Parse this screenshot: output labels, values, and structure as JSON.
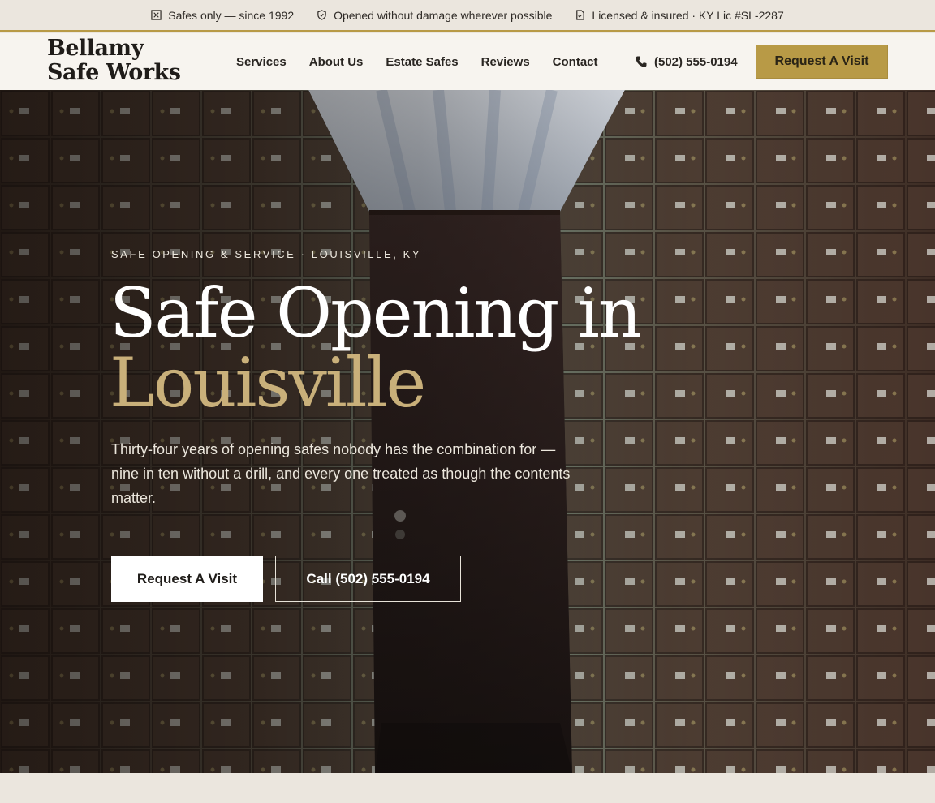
{
  "topbar": {
    "items": [
      {
        "icon": "safe-icon",
        "text": "Safes only — since 1992"
      },
      {
        "icon": "shield-icon",
        "text": "Opened without damage wherever possible"
      },
      {
        "icon": "document-check-icon",
        "text": "Licensed & insured · KY Lic #SL-2287"
      }
    ]
  },
  "header": {
    "logo": "Bellamy Safe Works",
    "nav": [
      "Services",
      "About Us",
      "Estate Safes",
      "Reviews",
      "Contact"
    ],
    "phone": "(502) 555-0194",
    "cta": "Request A Visit"
  },
  "hero": {
    "eyebrow": "Safe Opening & Service · Louisville, KY",
    "title_line1": "Safe Opening in",
    "title_accent": "Louisville",
    "lede": "Thirty-four years of opening safes nobody has the combination for — nine in ten without a drill, and every one treated as though the contents matter.",
    "primary_cta": "Request A Visit",
    "secondary_cta": "Call (502) 555-0194"
  },
  "colors": {
    "gold": "#b89a46",
    "accent_text": "#c9b07a",
    "cream": "#ebe6de",
    "header_bg": "#f7f4ef"
  }
}
